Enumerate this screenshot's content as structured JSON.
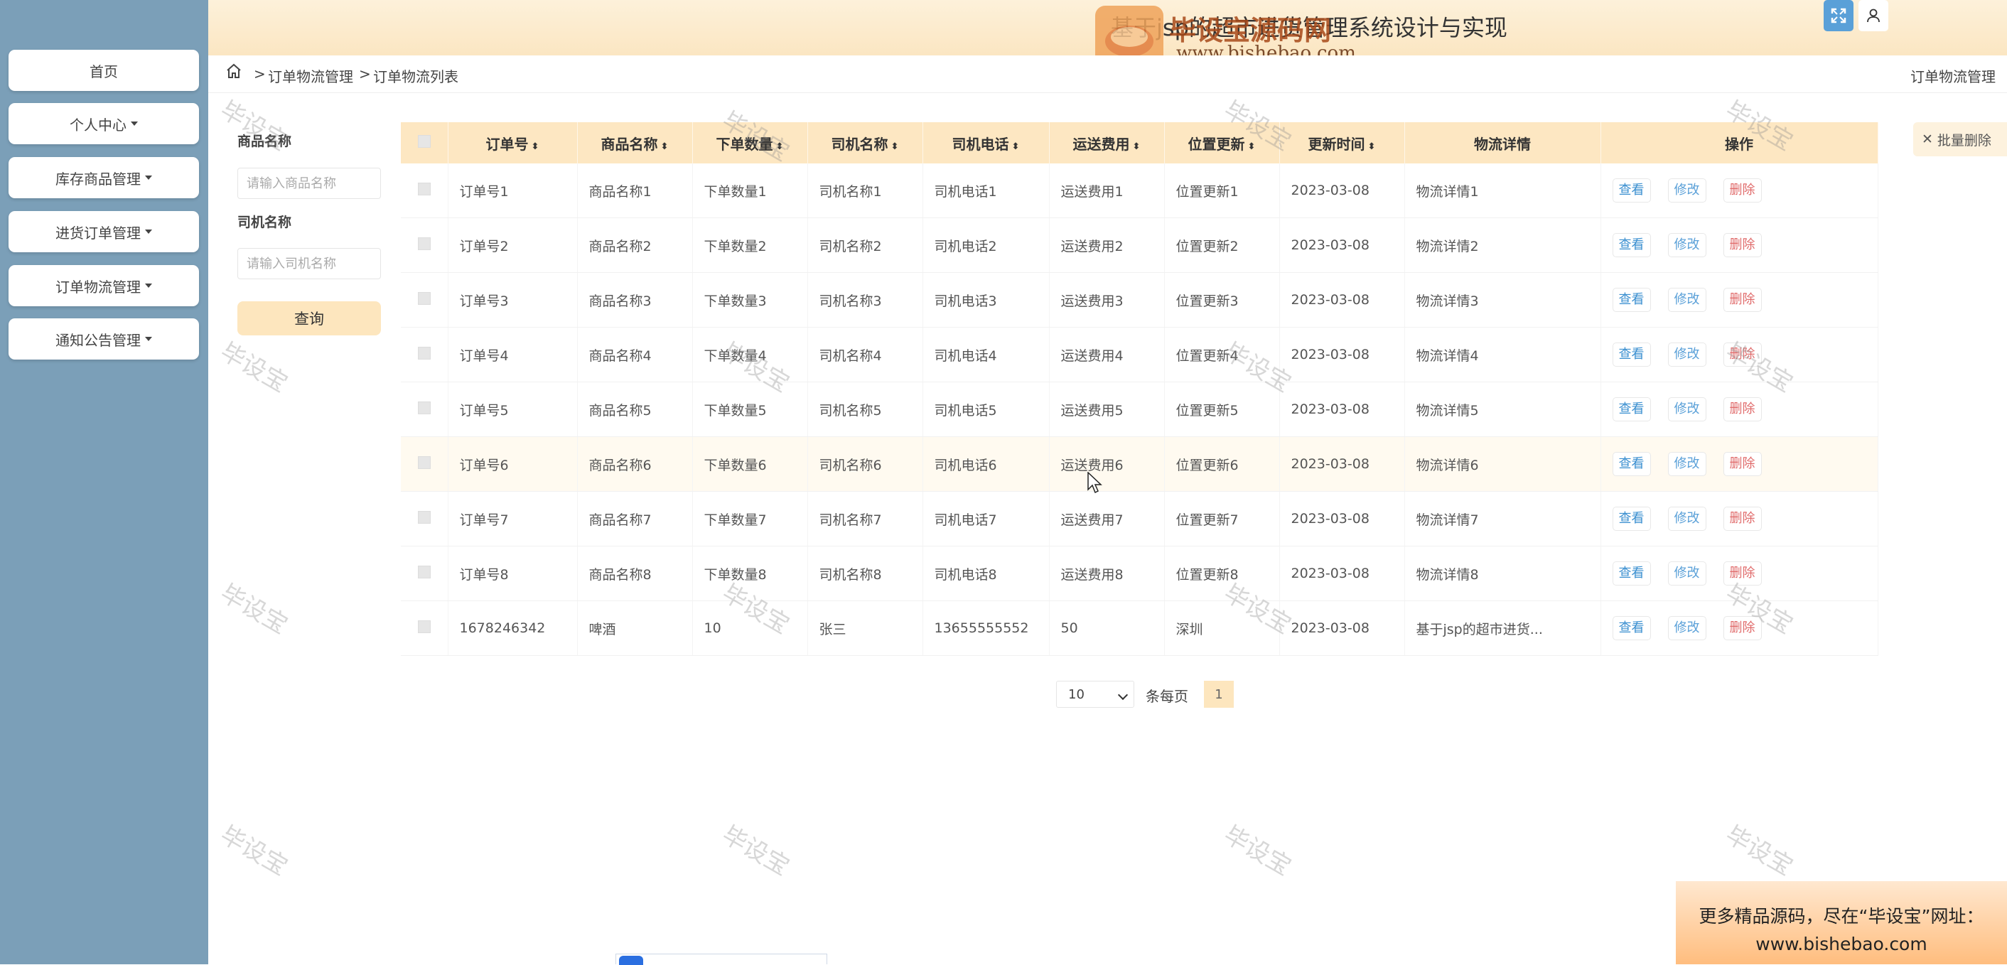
{
  "header": {
    "app_title": "基于jsp的超市进货管理系统设计与实现",
    "logo_text": "毕设宝源码网",
    "logo_url": "www.bishebao.com"
  },
  "sidebar": {
    "items": [
      {
        "label": "首页"
      },
      {
        "label": "个人中心"
      },
      {
        "label": "库存商品管理"
      },
      {
        "label": "进货订单管理"
      },
      {
        "label": "订单物流管理"
      },
      {
        "label": "通知公告管理"
      }
    ]
  },
  "breadcrumb": {
    "sep": ">",
    "items": [
      "订单物流管理",
      "订单物流列表"
    ],
    "right": "订单物流管理"
  },
  "search": {
    "product_label": "商品名称",
    "product_placeholder": "请输入商品名称",
    "driver_label": "司机名称",
    "driver_placeholder": "请输入司机名称",
    "query_label": "查询"
  },
  "batch_delete_label": "批量删除",
  "table": {
    "headers": [
      "订单号",
      "商品名称",
      "下单数量",
      "司机名称",
      "司机电话",
      "运送费用",
      "位置更新",
      "更新时间",
      "物流详情",
      "操作"
    ],
    "actions": {
      "view": "查看",
      "edit": "修改",
      "delete": "删除"
    },
    "rows": [
      [
        "订单号1",
        "商品名称1",
        "下单数量1",
        "司机名称1",
        "司机电话1",
        "运送费用1",
        "位置更新1",
        "2023-03-08",
        "物流详情1"
      ],
      [
        "订单号2",
        "商品名称2",
        "下单数量2",
        "司机名称2",
        "司机电话2",
        "运送费用2",
        "位置更新2",
        "2023-03-08",
        "物流详情2"
      ],
      [
        "订单号3",
        "商品名称3",
        "下单数量3",
        "司机名称3",
        "司机电话3",
        "运送费用3",
        "位置更新3",
        "2023-03-08",
        "物流详情3"
      ],
      [
        "订单号4",
        "商品名称4",
        "下单数量4",
        "司机名称4",
        "司机电话4",
        "运送费用4",
        "位置更新4",
        "2023-03-08",
        "物流详情4"
      ],
      [
        "订单号5",
        "商品名称5",
        "下单数量5",
        "司机名称5",
        "司机电话5",
        "运送费用5",
        "位置更新5",
        "2023-03-08",
        "物流详情5"
      ],
      [
        "订单号6",
        "商品名称6",
        "下单数量6",
        "司机名称6",
        "司机电话6",
        "运送费用6",
        "位置更新6",
        "2023-03-08",
        "物流详情6"
      ],
      [
        "订单号7",
        "商品名称7",
        "下单数量7",
        "司机名称7",
        "司机电话7",
        "运送费用7",
        "位置更新7",
        "2023-03-08",
        "物流详情7"
      ],
      [
        "订单号8",
        "商品名称8",
        "下单数量8",
        "司机名称8",
        "司机电话8",
        "运送费用8",
        "位置更新8",
        "2023-03-08",
        "物流详情8"
      ],
      [
        "1678246342",
        "啤酒",
        "10",
        "张三",
        "13655555552",
        "50",
        "深圳",
        "2023-03-08",
        "基于jsp的超市进货..."
      ]
    ]
  },
  "pagination": {
    "page_size": "10",
    "per_page_label": "条每页",
    "current_page": "1"
  },
  "watermark_text": "毕设宝",
  "ad": {
    "line1": "更多精品源码，尽在“毕设宝”网址：",
    "line2": "www.bishebao.com"
  },
  "colors": {
    "sidebar_bg": "#7b9fb8",
    "header_bg": "#fbe6c2",
    "table_header_bg": "#fde7c2",
    "accent_blue": "#3a8fd0",
    "delete_red": "#e06a6a"
  }
}
